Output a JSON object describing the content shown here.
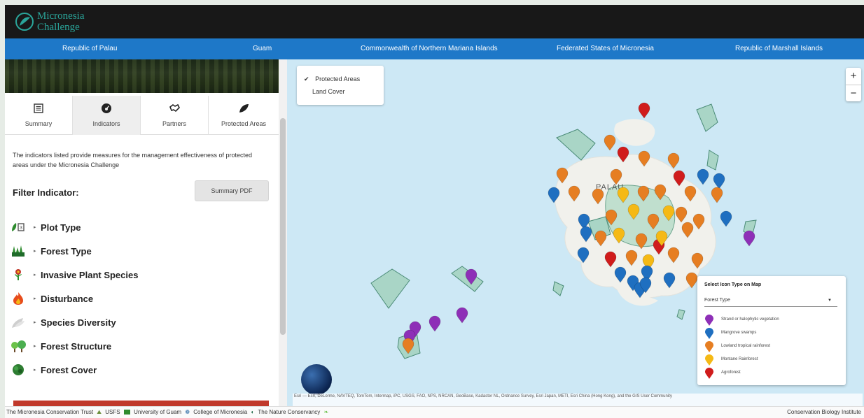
{
  "header": {
    "logo_line1": "Micronesia",
    "logo_line2": "Challenge"
  },
  "nav": {
    "items": [
      "Republic of Palau",
      "Guam",
      "Commonwealth of Northern Mariana Islands",
      "Federated States of Micronesia",
      "Republic of Marshall Islands"
    ]
  },
  "sidebar": {
    "tabs": [
      {
        "label": "Summary",
        "icon": "list-icon"
      },
      {
        "label": "Indicators",
        "icon": "gauge-icon"
      },
      {
        "label": "Partners",
        "icon": "handshake-icon"
      },
      {
        "label": "Protected Areas",
        "icon": "leaf-icon"
      }
    ],
    "active_tab": "Indicators",
    "description": "The indicators listed provide measures for the management effectiveness of protected areas under the Micronesia Challenge",
    "filter_title": "Filter Indicator:",
    "pdf_button": "Summary PDF",
    "indicators": [
      {
        "label": "Plot Type",
        "icon": "plot-type-icon"
      },
      {
        "label": "Forest Type",
        "icon": "forest-type-icon"
      },
      {
        "label": "Invasive Plant Species",
        "icon": "invasive-plant-icon"
      },
      {
        "label": "Disturbance",
        "icon": "fire-icon"
      },
      {
        "label": "Species Diversity",
        "icon": "species-diversity-icon"
      },
      {
        "label": "Forest Structure",
        "icon": "forest-structure-icon"
      },
      {
        "label": "Forest Cover",
        "icon": "forest-cover-icon"
      }
    ]
  },
  "map": {
    "layers": [
      {
        "label": "Protected Areas",
        "checked": true
      },
      {
        "label": "Land Cover",
        "checked": false
      }
    ],
    "place_label": "PALAU",
    "zoom_in": "+",
    "zoom_out": "−",
    "attribution": "Esri — Esri, DeLorme, NAVTEQ, TomTom, Intermap, iPC, USGS, FAO, NPS, NRCAN, GeoBase, Kadaster NL, Ordnance Survey, Esri Japan, METI, Esri China (Hong Kong), and the GIS User Community",
    "legend": {
      "title": "Select Icon Type on Map",
      "selected": "Forest Type",
      "items": [
        {
          "label": "Strand or halophytic vegetation",
          "color": "#8e2fb7"
        },
        {
          "label": "Mangrove swamps",
          "color": "#1f6fc0"
        },
        {
          "label": "Lowland tropical rainforest",
          "color": "#e67e22"
        },
        {
          "label": "Montane Rainforest",
          "color": "#f5b915"
        },
        {
          "label": "Agroforest",
          "color": "#d01c1c"
        }
      ]
    }
  },
  "footer": {
    "partners": [
      "The Micronesia Conservation Trust",
      "USFS",
      "University of Guam",
      "College of Micronesia",
      "The Nature Conservancy"
    ],
    "right": "Conservation Biology Institute"
  }
}
